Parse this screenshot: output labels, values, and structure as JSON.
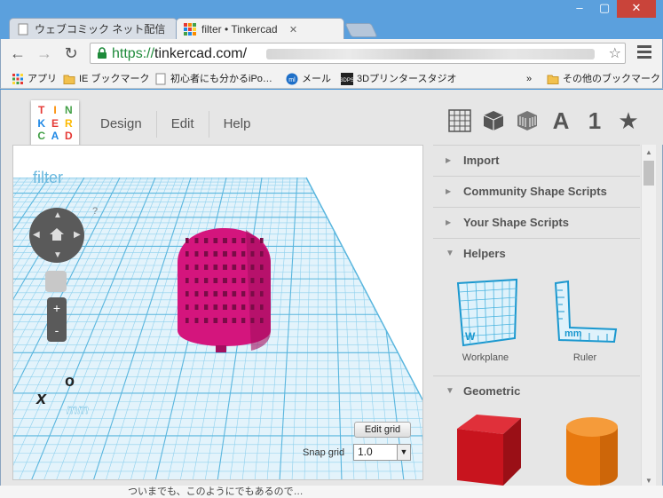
{
  "browser": {
    "tabs": [
      {
        "title": "ウェブコミック ネット配信 違",
        "active": false
      },
      {
        "title": "filter • Tinkercad",
        "active": true
      }
    ],
    "url_scheme": "https://",
    "url_host": "tinkercad.com/",
    "bookmarks": [
      {
        "label": "アプリ",
        "icon": "apps-grid-icon"
      },
      {
        "label": "IE ブックマーク",
        "icon": "folder-icon"
      },
      {
        "label": "初心者にも分かるiPo…",
        "icon": "page-icon"
      },
      {
        "label": "メール",
        "icon": "ml-icon"
      },
      {
        "label": "3Dプリンタースタジオ",
        "icon": "3dps-icon"
      },
      {
        "label": "»",
        "icon": ""
      },
      {
        "label": "その他のブックマーク",
        "icon": "folder-icon"
      }
    ]
  },
  "app": {
    "logo_letters": [
      "T",
      "I",
      "N",
      "K",
      "E",
      "R",
      "C",
      "A",
      "D"
    ],
    "menu": [
      "Design",
      "Edit",
      "Help"
    ],
    "tool_text": {
      "letter": "A",
      "number": "1"
    },
    "viewport": {
      "title": "filter",
      "help_mark": "?",
      "zoom_in": "+",
      "zoom_out": "-",
      "axis_x": "x",
      "axis_o": "o",
      "unit": "mm",
      "edit_grid": "Edit grid",
      "snap_label": "Snap grid",
      "snap_value": "1.0"
    },
    "panel": {
      "sections": [
        {
          "label": "Import",
          "open": false
        },
        {
          "label": "Community Shape Scripts",
          "open": false
        },
        {
          "label": "Your Shape Scripts",
          "open": false
        },
        {
          "label": "Helpers",
          "open": true
        },
        {
          "label": "Geometric",
          "open": true
        }
      ],
      "helpers": [
        "Workplane",
        "Ruler"
      ],
      "workplane_mark": "W",
      "ruler_mark": "mm"
    },
    "colors": {
      "accent_grid": "#66c3e6",
      "shape_magenta": "#d4157d",
      "box_red": "#c8141e",
      "cylinder_orange": "#e8790f"
    }
  },
  "footer_text": "ついまでも、このようにでもあるので…"
}
